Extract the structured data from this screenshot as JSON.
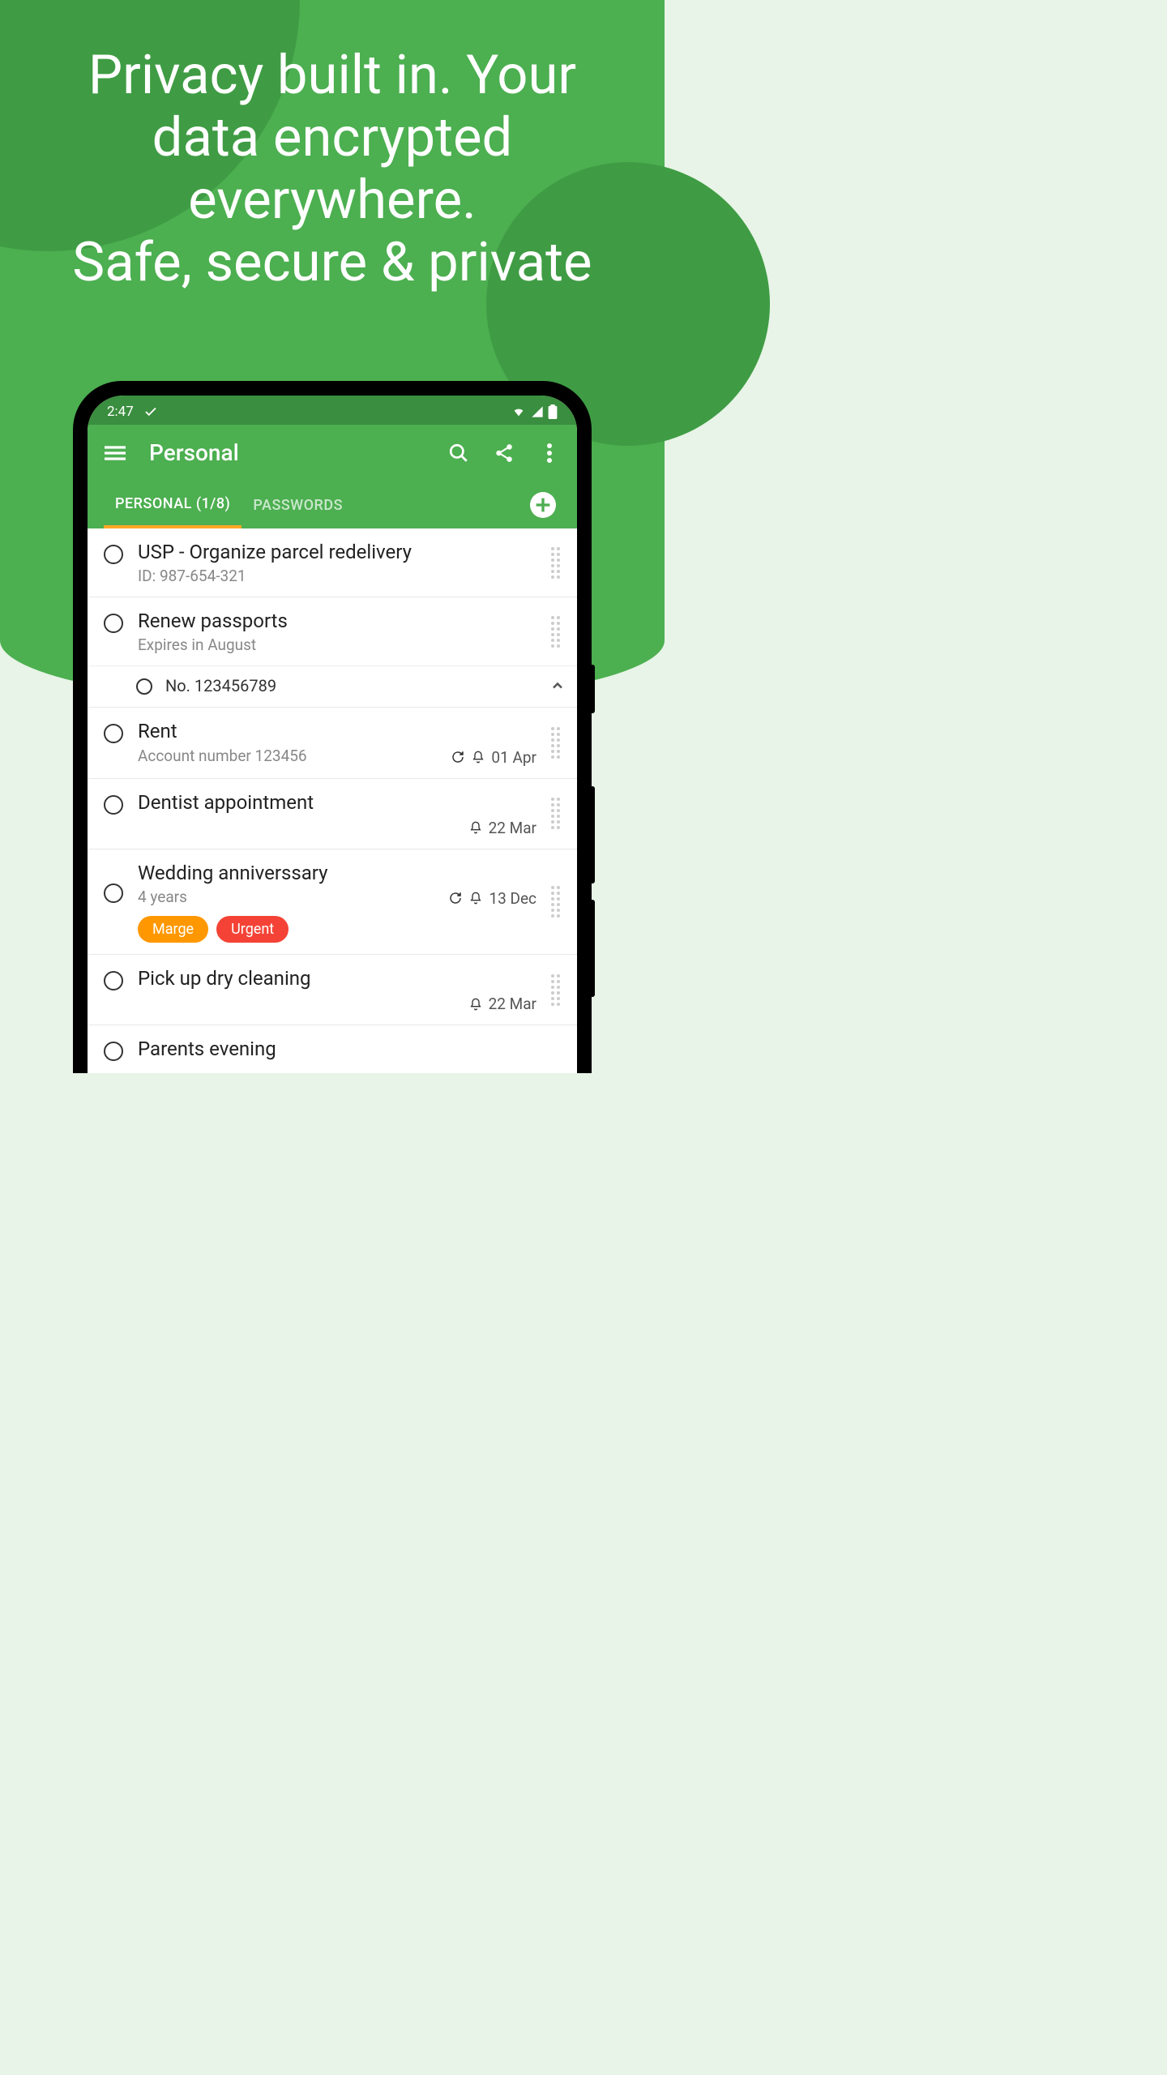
{
  "headline_line1": "Privacy built in. Your",
  "headline_line2": "data encrypted",
  "headline_line3": "everywhere.",
  "headline_line4": "Safe, secure & private",
  "status": {
    "time": "2:47"
  },
  "header": {
    "title": "Personal"
  },
  "tabs": {
    "personal": "PERSONAL (1/8)",
    "passwords": "PASSWORDS"
  },
  "items": [
    {
      "title": "USP - Organize parcel redelivery",
      "sub": "ID: 987-654-321"
    },
    {
      "title": "Renew passports",
      "sub": "Expires in August",
      "child": "No. 123456789"
    },
    {
      "title": "Rent",
      "sub": "Account number 123456",
      "date": "01 Apr",
      "recur": true,
      "bell": true
    },
    {
      "title": "Dentist appointment",
      "date": "22 Mar",
      "bell": true
    },
    {
      "title": "Wedding anniverssary",
      "sub": "4 years",
      "date": "13 Dec",
      "recur": true,
      "bell": true,
      "tags": [
        {
          "text": "Marge",
          "color": "orange"
        },
        {
          "text": "Urgent",
          "color": "red"
        }
      ]
    },
    {
      "title": "Pick up dry cleaning",
      "date": "22 Mar",
      "bell": true
    },
    {
      "title": "Parents evening"
    }
  ]
}
